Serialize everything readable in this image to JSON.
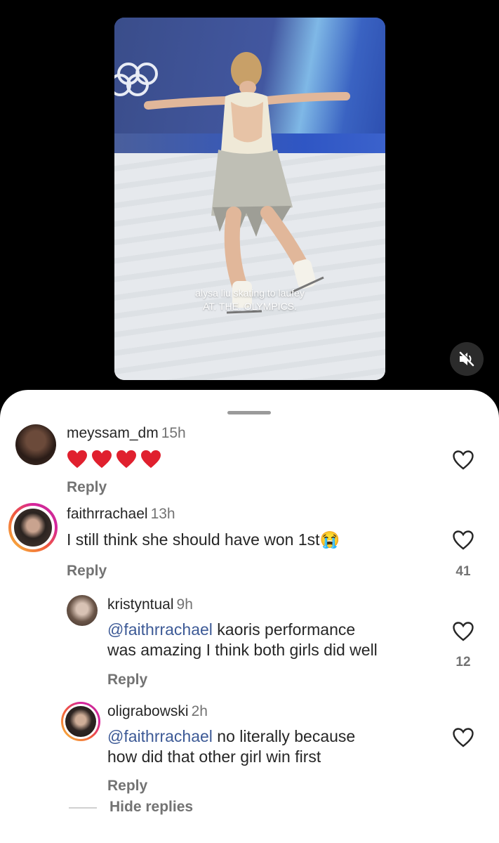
{
  "video": {
    "caption_line1": "alysa liu skating to laufey",
    "caption_line2": "AT. THE. OLYMPICS.",
    "mute_icon": "speaker-muted-icon"
  },
  "comments": [
    {
      "username": "meyssam_dm",
      "time": "15h",
      "text": "❤️❤️❤️❤️",
      "hearts": 4,
      "reply_label": "Reply",
      "likes": ""
    },
    {
      "username": "faithrrachael",
      "time": "13h",
      "text": "I still think she should have won 1st",
      "emoji": "😭",
      "reply_label": "Reply",
      "likes": "41"
    },
    {
      "username": "kristyntual",
      "time": "9h",
      "mention": "@faithrrachael",
      "text_line1": " kaoris performance",
      "text_line2": "was amazing I think both girls did well",
      "reply_label": "Reply",
      "likes": "12"
    },
    {
      "username": "oligrabowski",
      "time": "2h",
      "mention": "@faithrrachael",
      "text_line1": " no literally because",
      "text_line2": "how did that other girl win first",
      "reply_label": "Reply",
      "likes": ""
    }
  ],
  "hide_replies_label": "Hide replies",
  "colors": {
    "mention": "#3d5a96",
    "secondary_text": "#737373",
    "heart_red": "#e0202e"
  }
}
